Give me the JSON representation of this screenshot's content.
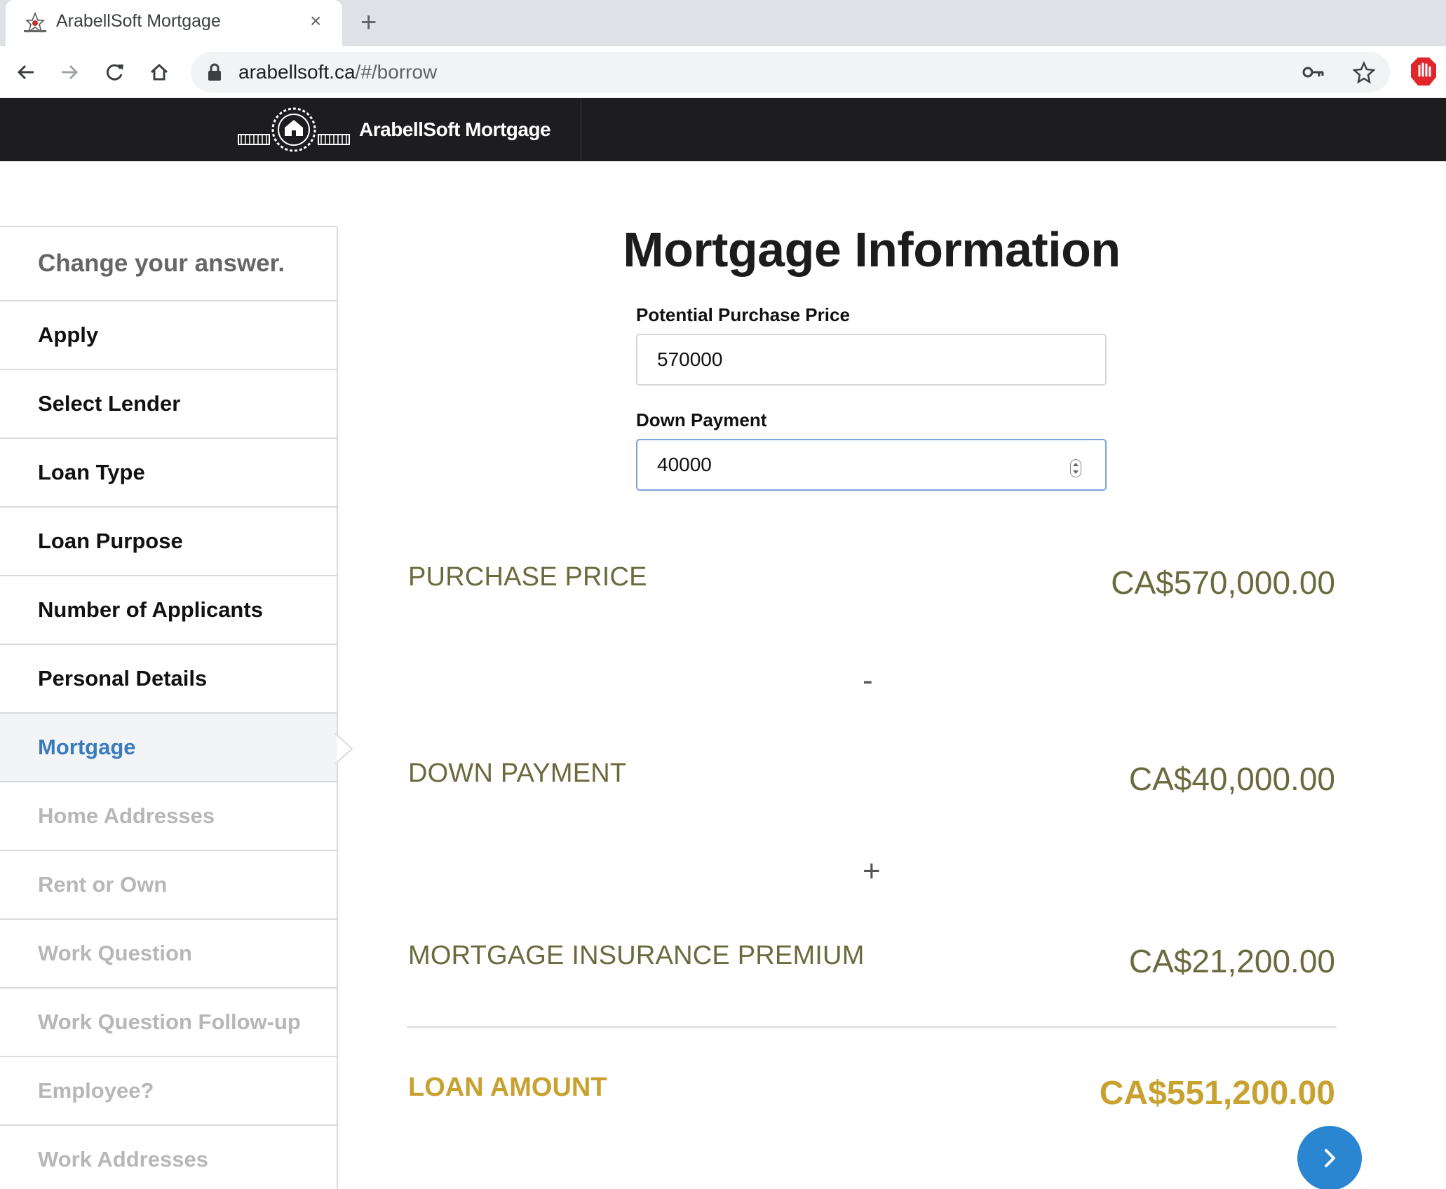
{
  "browser": {
    "tab_title": "ArabellSoft Mortgage",
    "close_glyph": "×",
    "new_tab_glyph": "+",
    "url_host": "arabellsoft.ca",
    "url_path": "/#/borrow"
  },
  "header": {
    "brand_name": "ArabellSoft Mortgage"
  },
  "sidebar": {
    "heading": "Change your answer.",
    "items": [
      {
        "label": "Apply",
        "state": "done"
      },
      {
        "label": "Select Lender",
        "state": "done"
      },
      {
        "label": "Loan Type",
        "state": "done"
      },
      {
        "label": "Loan Purpose",
        "state": "done"
      },
      {
        "label": "Number of Applicants",
        "state": "done"
      },
      {
        "label": "Personal Details",
        "state": "done"
      },
      {
        "label": "Mortgage",
        "state": "active"
      },
      {
        "label": "Home Addresses",
        "state": "todo"
      },
      {
        "label": "Rent or Own",
        "state": "todo"
      },
      {
        "label": "Work Question",
        "state": "todo"
      },
      {
        "label": "Work Question Follow-up",
        "state": "todo"
      },
      {
        "label": "Employee?",
        "state": "todo"
      },
      {
        "label": "Work Addresses",
        "state": "todo"
      }
    ]
  },
  "main": {
    "title": "Mortgage Information",
    "purchase_price_label": "Potential Purchase Price",
    "purchase_price_value": "570000",
    "down_payment_label": "Down Payment",
    "down_payment_value": "40000",
    "summary": {
      "purchase_price_label": "PURCHASE PRICE",
      "purchase_price_value": "CA$570,000.00",
      "minus": "-",
      "down_payment_label": "DOWN PAYMENT",
      "down_payment_value": "CA$40,000.00",
      "plus": "+",
      "insurance_label": "MORTGAGE INSURANCE PREMIUM",
      "insurance_value": "CA$21,200.00",
      "loan_label": "LOAN AMOUNT",
      "loan_value": "CA$551,200.00"
    }
  },
  "colors": {
    "header_bg": "#1d1d1f",
    "summary_text": "#6b6a3e",
    "loan_gold": "#c8a230",
    "active_blue": "#3a7bbf",
    "next_button": "#2a86d0"
  }
}
